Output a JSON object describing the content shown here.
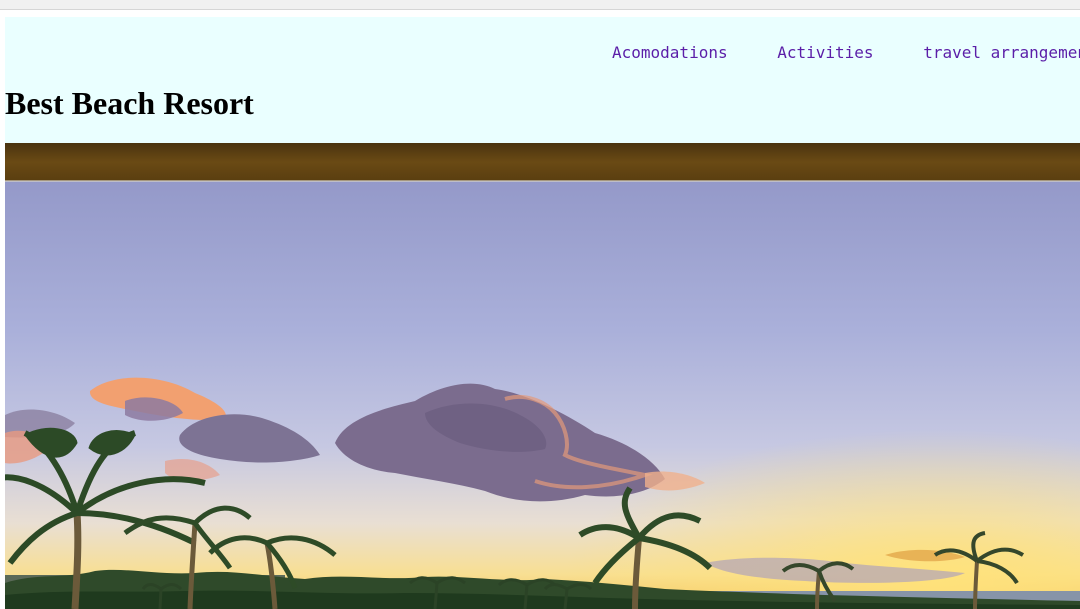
{
  "header": {
    "nav": [
      "Acomodations",
      "Activities",
      "travel arrangements"
    ],
    "title": "Best Beach Resort"
  },
  "hero": {
    "alt": "Sunset over palm trees and the ocean seen from a balcony",
    "colors": {
      "header_bg": "#eaffff",
      "nav_link": "#5b1ea8",
      "sky_top": "#9aa0d0",
      "sky_bottom": "#f7e08a",
      "roof_beam": "#5a3e10"
    }
  }
}
